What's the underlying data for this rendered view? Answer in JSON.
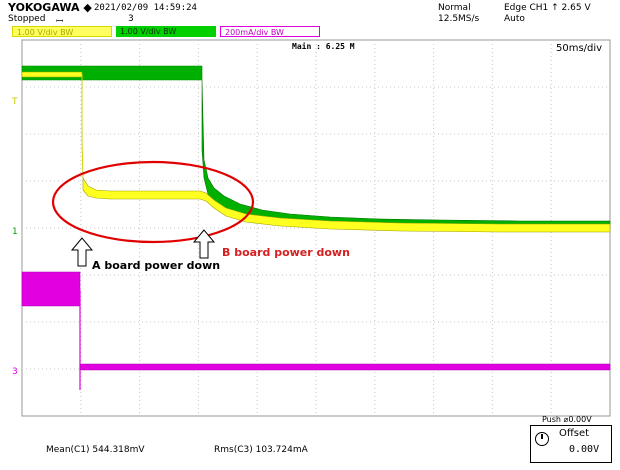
{
  "header": {
    "brand": "YOKOGAWA ◆",
    "state": "Stopped",
    "state_icon": "trigger-icon",
    "datetime": "2021/02/09 14:59:24",
    "acq_count": "3",
    "mode": "Normal",
    "sample_rate": "12.5MS/s",
    "trigger_edge": "Edge CH1 ↑ 2.65 V",
    "trigger_mode": "Auto"
  },
  "channels": [
    {
      "label": "1.00 V/div",
      "bw": "BW",
      "color": "#ffff00"
    },
    {
      "label": "1.00 V/div",
      "bw": "BW",
      "color": "#00c000"
    },
    {
      "label": "200mA/div",
      "bw": "BW",
      "color": "#ff00ff"
    }
  ],
  "timebase": {
    "main_label": "Main : 6.25 M",
    "per_div": "50ms/div"
  },
  "markers": {
    "trigger_level": "T",
    "ch1_ground": "1",
    "ch3_ground": "3"
  },
  "annotations": {
    "a_label": "A board power down",
    "b_label": "B board power down"
  },
  "measurements": {
    "mean": "Mean(C1)   544.318mV",
    "rms": "Rms(C3)   103.724mA"
  },
  "offset_panel": {
    "push_label": "Push",
    "push_value": "0.00V",
    "title": "Offset",
    "value": "0.00V"
  },
  "colors": {
    "ch1": "#e8e800",
    "ch2": "#00b000",
    "ch3": "#e000e0",
    "highlight": "#e00000",
    "grid": "#c8c8c8"
  }
}
